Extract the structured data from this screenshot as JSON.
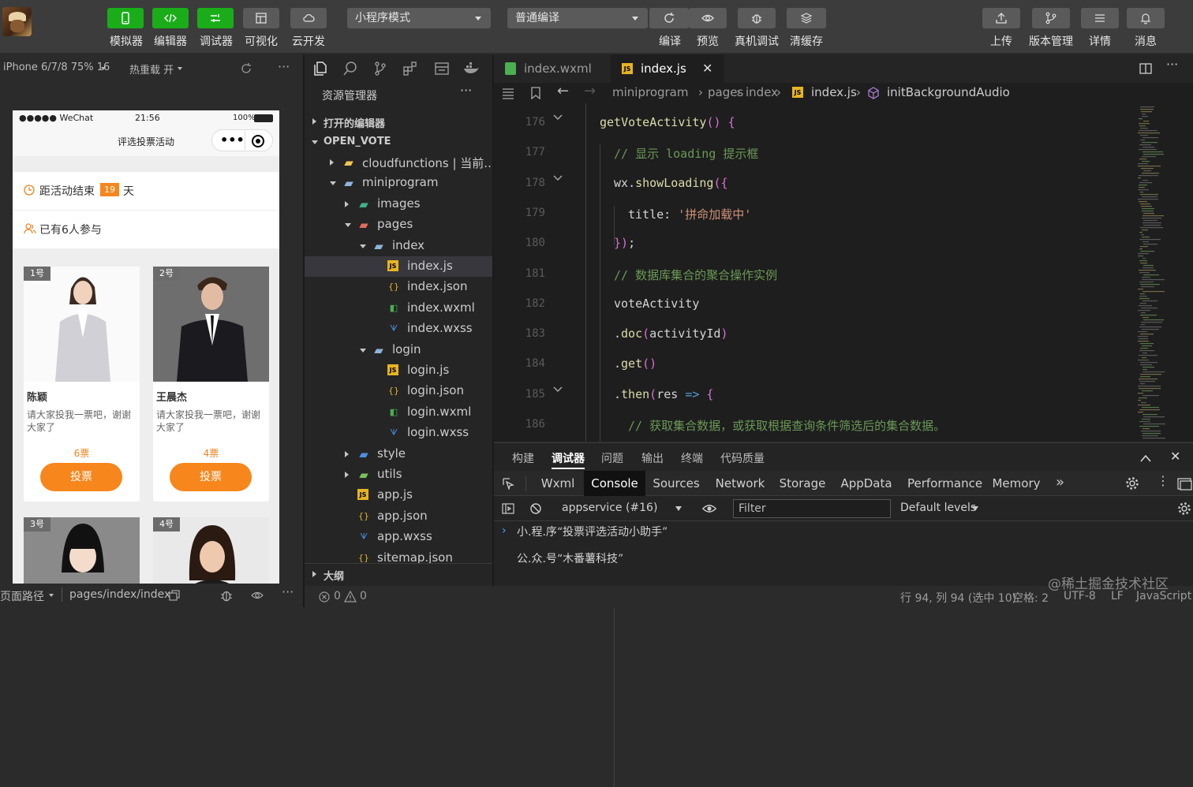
{
  "toolbar": {
    "left_buttons": [
      {
        "label": "模拟器",
        "icon": "phone-icon"
      },
      {
        "label": "编辑器",
        "icon": "code-icon"
      },
      {
        "label": "调试器",
        "icon": "debug-icon"
      },
      {
        "label": "可视化",
        "icon": "layout-icon"
      },
      {
        "label": "云开发",
        "icon": "cloud-icon"
      }
    ],
    "mode_select": "小程序模式",
    "compile_select": "普通编译",
    "mid_labels": [
      "编译",
      "预览",
      "真机调试",
      "清缓存"
    ],
    "right_labels": [
      "上传",
      "版本管理",
      "详情",
      "消息"
    ]
  },
  "simulator": {
    "device": "iPhone 6/7/8 75% 16",
    "hot_reload": "热重载 开",
    "status_carrier": "●●●●● WeChat",
    "status_time": "21:56",
    "status_battery": "100%",
    "nav_title": "评选投票活动",
    "countdown_prefix": "距活动结束",
    "countdown_days": "19",
    "countdown_suffix": "天",
    "participants": "已有6人参与",
    "cards": [
      {
        "badge": "1号",
        "name": "陈颖",
        "desc": "请大家投我一票吧，谢谢大家了",
        "votes": "6票",
        "btn": "投票"
      },
      {
        "badge": "2号",
        "name": "王晨杰",
        "desc": "请大家投我一票吧，谢谢大家了",
        "votes": "4票",
        "btn": "投票"
      },
      {
        "badge": "3号"
      },
      {
        "badge": "4号"
      }
    ],
    "footer_path_label": "页面路径",
    "footer_path": "pages/index/index"
  },
  "explorer": {
    "title": "资源管理器",
    "sections": {
      "open_editors": "打开的编辑器",
      "project": "OPEN_VOTE",
      "outline": "大纲"
    },
    "tree": [
      {
        "name": "cloudfunctions | 当前...",
        "type": "folder-cloud"
      },
      {
        "name": "miniprogram",
        "type": "folder-open"
      },
      {
        "name": "images",
        "type": "folder-img"
      },
      {
        "name": "pages",
        "type": "folder-pages"
      },
      {
        "name": "index",
        "type": "folder-open"
      },
      {
        "name": "index.js",
        "type": "js"
      },
      {
        "name": "index.json",
        "type": "json"
      },
      {
        "name": "index.wxml",
        "type": "wxml"
      },
      {
        "name": "index.wxss",
        "type": "wxss"
      },
      {
        "name": "login",
        "type": "folder-open"
      },
      {
        "name": "login.js",
        "type": "js"
      },
      {
        "name": "login.json",
        "type": "json"
      },
      {
        "name": "login.wxml",
        "type": "wxml"
      },
      {
        "name": "login.wxss",
        "type": "wxss"
      },
      {
        "name": "style",
        "type": "folder-style"
      },
      {
        "name": "utils",
        "type": "folder-utils"
      },
      {
        "name": "app.js",
        "type": "js"
      },
      {
        "name": "app.json",
        "type": "json"
      },
      {
        "name": "app.wxss",
        "type": "wxss"
      },
      {
        "name": "sitemap.json",
        "type": "json"
      }
    ]
  },
  "editor": {
    "tabs": [
      {
        "name": "index.wxml"
      },
      {
        "name": "index.js"
      }
    ],
    "breadcrumb": [
      "miniprogram",
      "pages",
      "index",
      "index.js",
      "initBackgroundAudio"
    ],
    "lines": [
      {
        "num": "176",
        "text": "getVoteActivity() {"
      },
      {
        "num": "177",
        "text": "// 显示 loading 提示框"
      },
      {
        "num": "178",
        "text": "wx.showLoading({"
      },
      {
        "num": "179",
        "text": "title: '拼命加载中'"
      },
      {
        "num": "180",
        "text": "});"
      },
      {
        "num": "181",
        "text": "// 数据库集合的聚合操作实例"
      },
      {
        "num": "182",
        "text": "voteActivity"
      },
      {
        "num": "183",
        "text": ".doc(activityId)"
      },
      {
        "num": "184",
        "text": ".get()"
      },
      {
        "num": "185",
        "text": ".then(res => {"
      },
      {
        "num": "186",
        "text": "// 获取集合数据，或获取根据查询条件筛选后的集合数据。"
      }
    ]
  },
  "debug": {
    "tabs": [
      "构建",
      "调试器",
      "问题",
      "输出",
      "终端",
      "代码质量"
    ],
    "devtools_tabs": [
      "Wxml",
      "Console",
      "Sources",
      "Network",
      "Storage",
      "AppData",
      "Performance",
      "Memory"
    ],
    "context": "appservice (#16)",
    "filter_placeholder": "Filter",
    "levels": "Default levels",
    "logs": [
      "小.程.序“投票评选活动小助手”",
      "公.众.号“木番薯科技”"
    ]
  },
  "statusbar": {
    "errors": "0",
    "warnings": "0",
    "position": "行 94, 列 94 (选中 10)",
    "spaces": "空格: 2",
    "encoding": "UTF-8",
    "eol": "LF",
    "language": "JavaScript",
    "watermark": "@稀土掘金技术社区"
  },
  "colors": {
    "accent_green": "#1aad19",
    "vote_orange": "#f7861c",
    "keyword_yellow": "#dcdcaa",
    "comment_green": "#6a9955",
    "string_orange": "#ce9178"
  }
}
